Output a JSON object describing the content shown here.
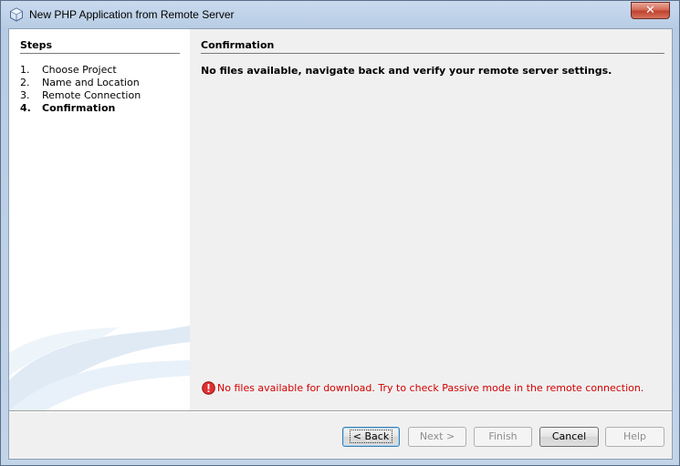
{
  "window": {
    "title": "New PHP Application from Remote Server",
    "close_glyph": "✕"
  },
  "steps": {
    "heading": "Steps",
    "items": [
      {
        "num": "1.",
        "label": "Choose Project"
      },
      {
        "num": "2.",
        "label": "Name and Location"
      },
      {
        "num": "3.",
        "label": "Remote Connection"
      },
      {
        "num": "4.",
        "label": "Confirmation",
        "current": true
      }
    ]
  },
  "panel": {
    "title": "Confirmation",
    "message": "No files available, navigate back and verify your remote server settings.",
    "error": "No files available for download. Try to check Passive mode in the remote connection."
  },
  "buttons": {
    "back": "< Back",
    "next": "Next >",
    "finish": "Finish",
    "cancel": "Cancel",
    "help": "Help"
  },
  "colors": {
    "error": "#d40000",
    "client_bg": "#f0f0f0",
    "close": "#c0422f"
  }
}
